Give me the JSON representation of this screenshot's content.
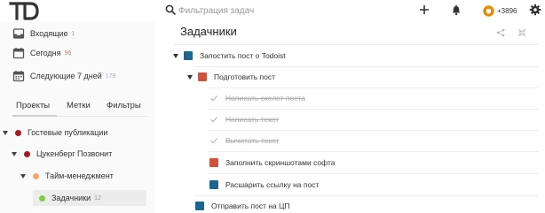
{
  "colors": {
    "red": "#d2513a",
    "blue": "#1d6591",
    "orange": "#f6a46e",
    "green": "#7ecc48",
    "dark_red": "#a81821",
    "karma_orange": "#ea8c00",
    "today_count": "#e8764e",
    "upcoming_count": "#b8a4cf",
    "inbox_count": "#999999"
  },
  "topbar": {
    "logo_icon": "todoist-logo-icon",
    "search_placeholder": "Фильтрация задач",
    "karma_score": "+3896"
  },
  "sidebar": {
    "nav": [
      {
        "label": "Входящие",
        "count": "1",
        "icon": "inbox-icon"
      },
      {
        "label": "Сегодня",
        "count": "96",
        "icon": "calendar-today-icon"
      },
      {
        "label": "Следующие 7 дней",
        "count": "179",
        "icon": "calendar-week-icon"
      }
    ],
    "tabs": [
      "Проекты",
      "Метки",
      "Фильтры"
    ],
    "projects": [
      {
        "label": "Гостевые публикации",
        "count": ""
      },
      {
        "label": "Цукенберг Позвонит",
        "count": ""
      },
      {
        "label": "Тайм-менеджмент",
        "count": ""
      },
      {
        "label": "Задачники",
        "count": "12"
      }
    ]
  },
  "main": {
    "title": "Задачники",
    "tasks": [
      {
        "label": "Запостить пост о Todoist",
        "done": false
      },
      {
        "label": "Подготовить пост",
        "done": false
      },
      {
        "label": "Написать скелет поста",
        "done": true
      },
      {
        "label": "Написать текст",
        "done": true
      },
      {
        "label": "Вычитать текст",
        "done": true
      },
      {
        "label": "Заполнить скриншотами софта",
        "done": false
      },
      {
        "label": "Расшарить ссылку на пост",
        "done": false
      },
      {
        "label": "Отправить пост на ЦП",
        "done": false
      }
    ]
  }
}
